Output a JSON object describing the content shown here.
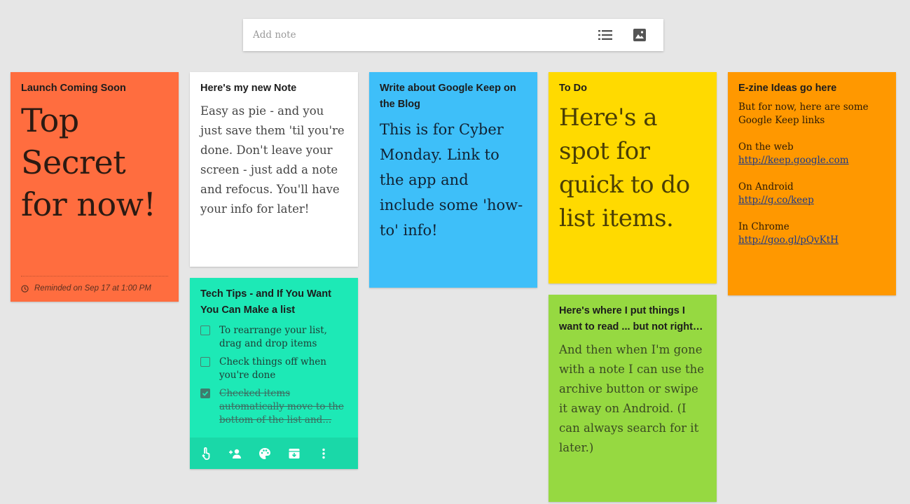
{
  "add_note": {
    "placeholder": "Add note",
    "list_icon": "list-icon",
    "image_icon": "image-icon"
  },
  "notes": {
    "launch": {
      "title": "Launch Coming Soon",
      "body": "Top Secret for now!",
      "reminder": "Reminded on Sep 17 at 1:00 PM",
      "reminder_icon": "clock-icon",
      "color": "#ff6d3f"
    },
    "new_note": {
      "title": "Here's my new Note",
      "body": "Easy as pie - and you just save them 'til you're done.  Don't leave your screen - just add a note and refocus.  You'll have your info for later!",
      "color": "#ffffff"
    },
    "google_keep": {
      "title": "Write about Google Keep on the Blog",
      "body": "This is for Cyber Monday.  Link to the app and include some 'how-to' info!",
      "color": "#3ebff9"
    },
    "todo": {
      "title": "To Do",
      "body": "Here's a spot for quick to do list items.",
      "color": "#ffda00"
    },
    "ezine": {
      "title": "E-zine Ideas go here",
      "intro": "But for now, here are some Google Keep links",
      "web_label": "On the web",
      "web_link": "http://keep.google.com",
      "android_label": "On Android",
      "android_link": "http://g.co/keep",
      "chrome_label": "In Chrome",
      "chrome_link": "http://goo.gl/pQvKtH",
      "color": "#ff9800"
    },
    "tech_tips": {
      "title": "Tech Tips - and If You Want You Can Make a list",
      "items": [
        {
          "text": "To rearrange your list, drag and drop items",
          "checked": false
        },
        {
          "text": "Check things off when you're done",
          "checked": false
        },
        {
          "text": "Checked items automatically move to the bottom of the list and...",
          "checked": true
        }
      ],
      "toolbar": [
        "remind-me-icon",
        "collaborator-icon",
        "palette-icon",
        "archive-icon",
        "more-vert-icon"
      ],
      "color": "#1de9b6"
    },
    "to_read": {
      "title": "Here's where I put things I want to read ... but not right…",
      "body": "And then when I'm gone with a note I can use the archive button or swipe it away on Android. (I can always search for it later.)",
      "color": "#96d941"
    }
  }
}
